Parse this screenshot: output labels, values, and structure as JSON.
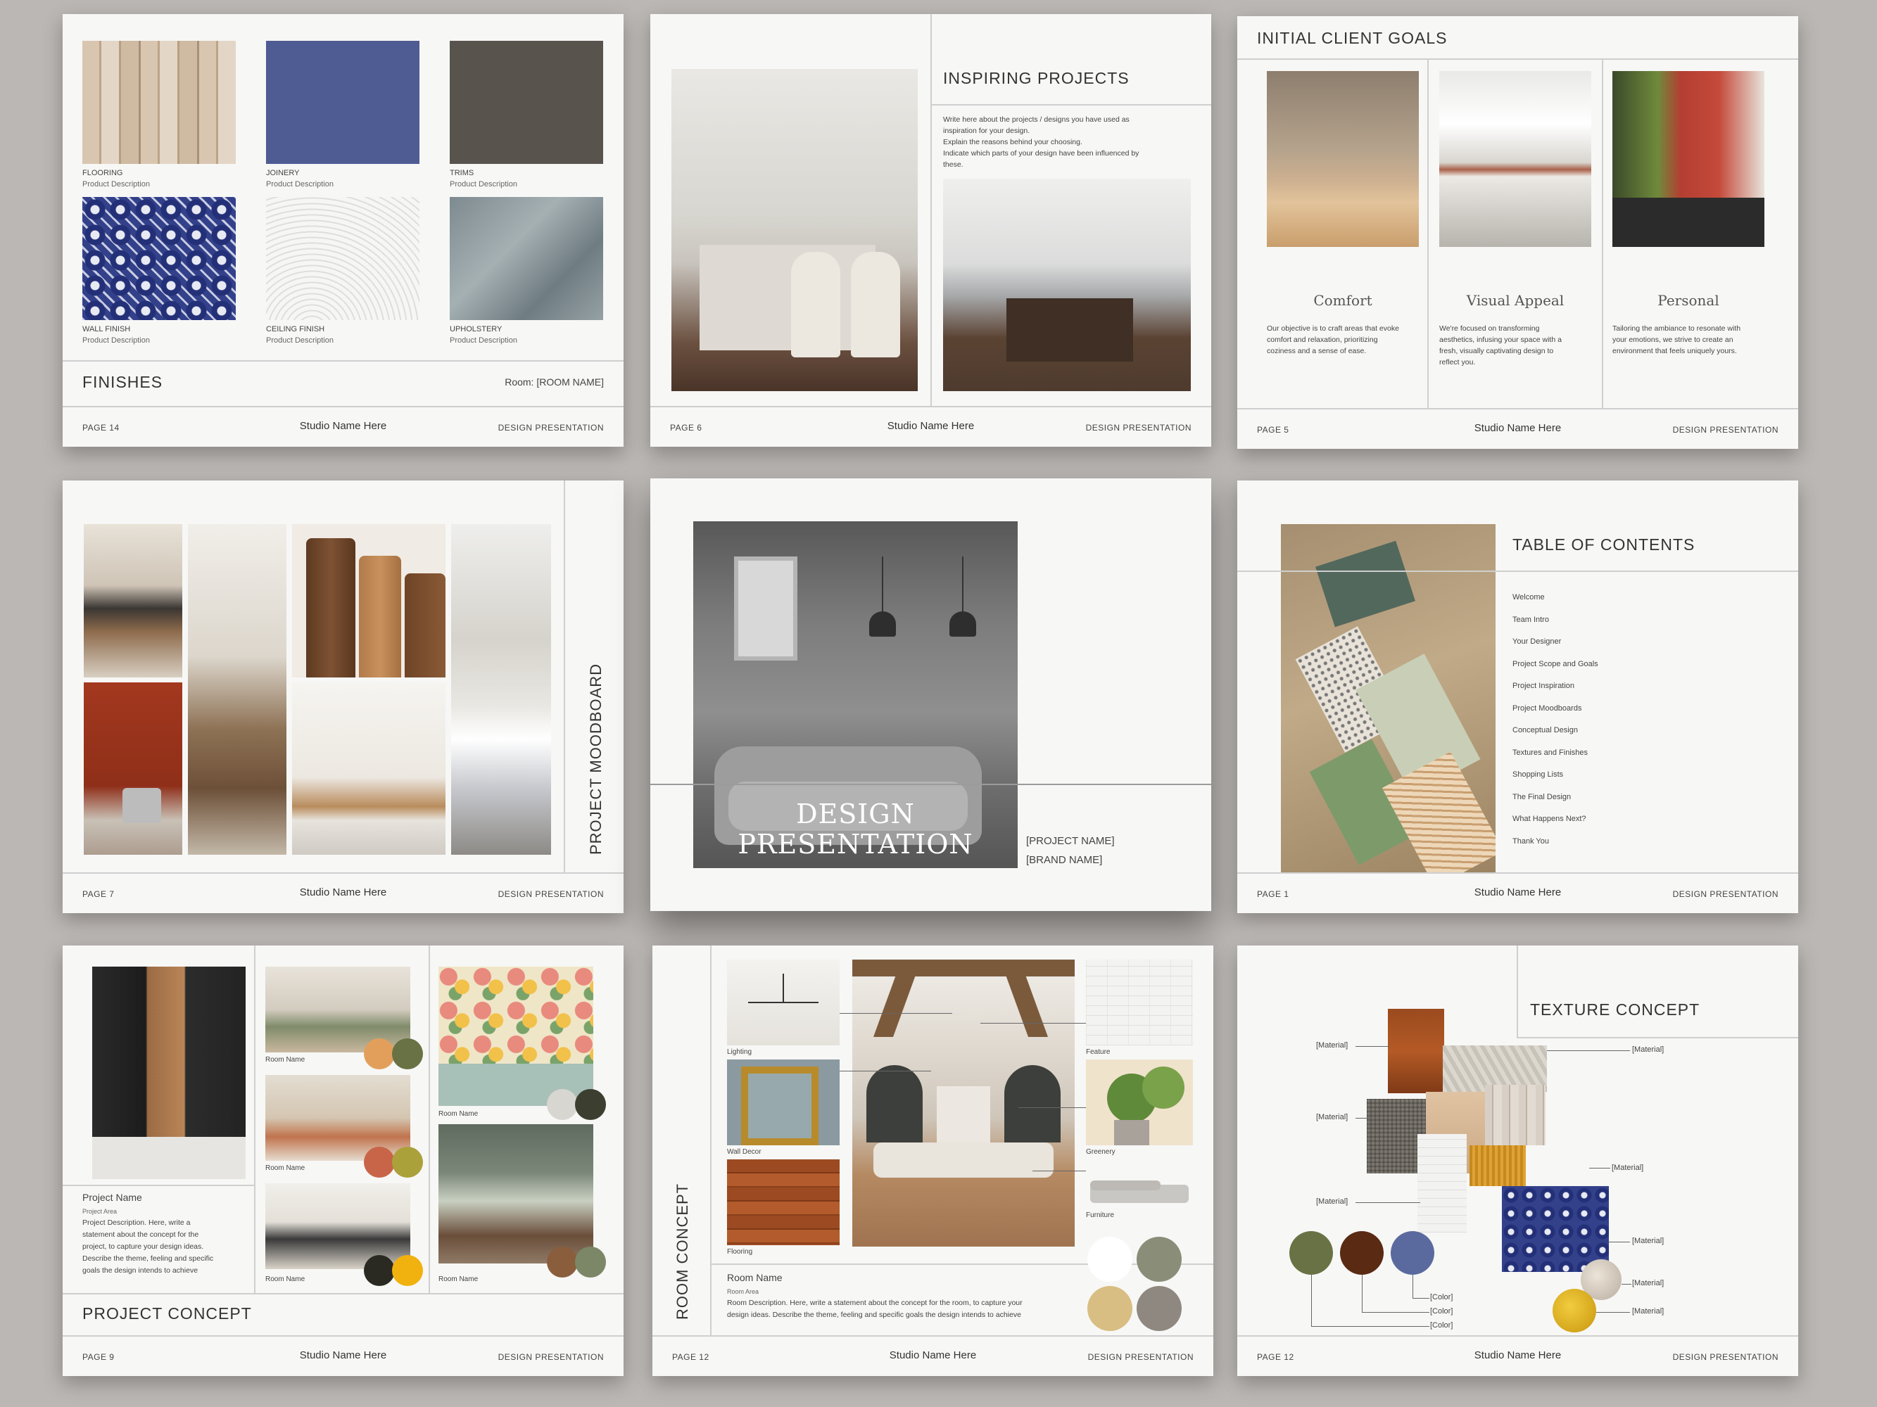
{
  "footer": {
    "studio": "Studio Name Here",
    "label": "DESIGN PRESENTATION"
  },
  "p14": {
    "page": "PAGE 14",
    "title": "FINISHES",
    "room": "Room: [ROOM NAME]",
    "items": [
      {
        "name": "FLOORING",
        "desc": "Product Description"
      },
      {
        "name": "JOINERY",
        "desc": "Product Description"
      },
      {
        "name": "TRIMS",
        "desc": "Product Description"
      },
      {
        "name": "WALL FINISH",
        "desc": "Product Description"
      },
      {
        "name": "CEILING FINISH",
        "desc": "Product Description"
      },
      {
        "name": "UPHOLSTERY",
        "desc": "Product Description"
      }
    ]
  },
  "p6": {
    "page": "PAGE 6",
    "title": "INSPIRING PROJECTS",
    "body": [
      "Write here about the projects / designs you have used as",
      "inspiration for your design.",
      "Explain the reasons behind your choosing.",
      "Indicate which parts of your design have been influenced by",
      "these."
    ]
  },
  "p5": {
    "page": "PAGE 5",
    "title": "INITIAL CLIENT GOALS",
    "goals": [
      {
        "name": "Comfort",
        "lines": [
          "Our objective is to craft areas that evoke",
          "comfort and relaxation, prioritizing",
          "coziness and a sense of ease."
        ]
      },
      {
        "name": "Visual Appeal",
        "lines": [
          "We're focused on transforming",
          "aesthetics, infusing your space with a",
          "fresh, visually captivating design to",
          "reflect you."
        ]
      },
      {
        "name": "Personal",
        "lines": [
          "Tailoring the ambiance to resonate with",
          "your emotions, we strive to create an",
          "environment that feels uniquely yours."
        ]
      }
    ]
  },
  "p7": {
    "page": "PAGE 7",
    "title": "PROJECT MOODBOARD"
  },
  "cover": {
    "title1": "DESIGN",
    "title2": "PRESENTATION",
    "project": "[PROJECT NAME]",
    "brand": "[BRAND NAME]"
  },
  "p1": {
    "page": "PAGE 1",
    "title": "TABLE OF CONTENTS",
    "items": [
      "Welcome",
      "Team Intro",
      "Your Designer",
      "Project Scope and Goals",
      "Project Inspiration",
      "Project Moodboards",
      "Conceptual Design",
      "Textures and Finishes",
      "Shopping Lists",
      "The Final Design",
      "What Happens Next?",
      "Thank You"
    ]
  },
  "p9": {
    "page": "PAGE 9",
    "title": "PROJECT CONCEPT",
    "project_name": "Project Name",
    "project_area": "Project Area",
    "desc": [
      "Project Description. Here, write a",
      "statement about the concept for the",
      "project, to capture your design ideas.",
      "Describe the theme, feeling and specific",
      "goals the design intends to achieve"
    ],
    "room_label": "Room Name"
  },
  "p12a": {
    "page": "PAGE 12",
    "title": "ROOM CONCEPT",
    "labels": {
      "lighting": "Lighting",
      "wall_decor": "Wall Decor",
      "flooring": "Flooring",
      "feature": "Feature",
      "greenery": "Greenery",
      "furniture": "Furniture"
    },
    "room_name": "Room Name",
    "room_area": "Room Area",
    "desc": [
      "Room Description. Here, write a statement about the concept for the room, to capture your",
      "design ideas. Describe the theme, feeling and specific goals the design intends to achieve"
    ]
  },
  "p12b": {
    "page": "PAGE 12",
    "title": "TEXTURE CONCEPT",
    "material": "[Material]",
    "color": "[Color]"
  },
  "colors": {
    "accent_blue": "#4f5b93",
    "trim_gray": "#58534d",
    "olive": "#687244",
    "brown": "#5a2a12",
    "mustard": "#d8a71a"
  }
}
